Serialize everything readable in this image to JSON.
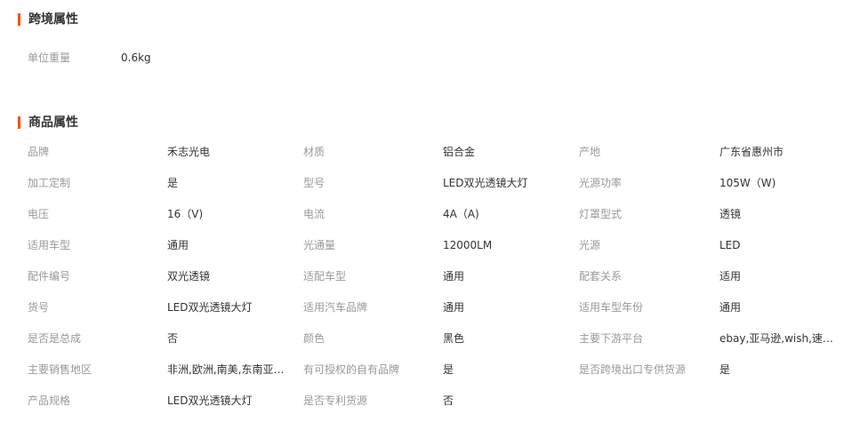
{
  "cross_border": {
    "title": "跨境属性",
    "rows": [
      {
        "label": "单位重量",
        "value": "0.6kg"
      }
    ]
  },
  "product": {
    "title": "商品属性",
    "rows": [
      [
        {
          "label": "品牌",
          "value": "禾志光电"
        },
        {
          "label": "材质",
          "value": "铝合金"
        },
        {
          "label": "产地",
          "value": "广东省惠州市"
        }
      ],
      [
        {
          "label": "加工定制",
          "value": "是"
        },
        {
          "label": "型号",
          "value": "LED双光透镜大灯"
        },
        {
          "label": "光源功率",
          "value": "105W（W)"
        }
      ],
      [
        {
          "label": "电压",
          "value": "16（V)"
        },
        {
          "label": "电流",
          "value": "4A（A)"
        },
        {
          "label": "灯罩型式",
          "value": "透镜"
        }
      ],
      [
        {
          "label": "适用车型",
          "value": "通用"
        },
        {
          "label": "光通量",
          "value": "12000LM"
        },
        {
          "label": "光源",
          "value": "LED"
        }
      ],
      [
        {
          "label": "配件编号",
          "value": "双光透镜"
        },
        {
          "label": "适配车型",
          "value": "通用"
        },
        {
          "label": "配套关系",
          "value": "适用"
        }
      ],
      [
        {
          "label": "货号",
          "value": "LED双光透镜大灯"
        },
        {
          "label": "适用汽车品牌",
          "value": "通用"
        },
        {
          "label": "适用车型年份",
          "value": "通用"
        }
      ],
      [
        {
          "label": "是否是总成",
          "value": "否"
        },
        {
          "label": "颜色",
          "value": "黑色"
        },
        {
          "label": "主要下游平台",
          "value": "ebay,亚马逊,wish,速卖..."
        }
      ],
      [
        {
          "label": "主要销售地区",
          "value": "非洲,欧洲,南美,东南亚,..."
        },
        {
          "label": "有可授权的自有品牌",
          "value": "是"
        },
        {
          "label": "是否跨境出口专供货源",
          "value": "是"
        }
      ],
      [
        {
          "label": "产品规格",
          "value": "LED双光透镜大灯"
        },
        {
          "label": "是否专利货源",
          "value": "否"
        }
      ]
    ]
  },
  "colors": {
    "accent": "#ff5000",
    "label": "#999999",
    "value": "#333333"
  }
}
